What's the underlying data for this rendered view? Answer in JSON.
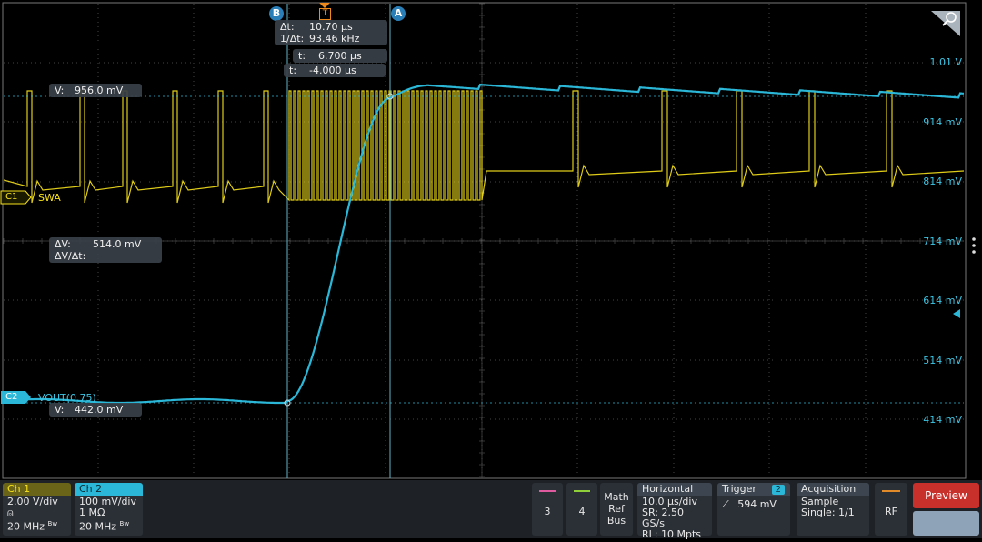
{
  "colors": {
    "ch1": "#f7e21c",
    "ch2": "#2bb8d8",
    "grid": "#444",
    "cursor": "#5fb3c8",
    "preview": "#c8302c",
    "ch3_bar": "#e05aa0",
    "ch4_bar": "#8fcf3a",
    "rf_bar": "#e08a2a"
  },
  "plot": {
    "ch1_marker": "C1",
    "ch1_label": "SWA",
    "ch2_marker": "C2",
    "ch2_label": "VOUT(0.75)",
    "y_labels": [
      "1.01 V",
      "914 mV",
      "814 mV",
      "714 mV",
      "614 mV",
      "514 mV",
      "414 mV"
    ],
    "trigger_marker": "T",
    "cursor_b": "B",
    "cursor_a": "A"
  },
  "readouts": {
    "delta_t_label": "Δt:",
    "delta_t": "10.70 µs",
    "inv_delta_t_label": "1/Δt:",
    "inv_delta_t": "93.46 kHz",
    "t_a_label": "t:",
    "t_a": "6.700 µs",
    "t_b_label": "t:",
    "t_b": "-4.000 µs",
    "v_upper_label": "V:",
    "v_upper": "956.0 mV",
    "delta_v_label": "ΔV:",
    "delta_v": "514.0 mV",
    "dv_dt_label": "ΔV/Δt:",
    "v_lower_label": "V:",
    "v_lower": "442.0 mV"
  },
  "bottom_bar": {
    "ch1": {
      "title": "Ch 1",
      "scale": "2.00 V/div",
      "coupling_icon": "dc-coupling-icon",
      "bw": "20 MHz",
      "bw_mark": "Bw"
    },
    "ch2": {
      "title": "Ch 2",
      "scale": "100 mV/div",
      "impedance": "1 MΩ",
      "bw": "20 MHz",
      "bw_mark": "Bw"
    },
    "ch3": "3",
    "ch4": "4",
    "math_ref_bus": [
      "Math",
      "Ref",
      "Bus"
    ],
    "horizontal": {
      "title": "Horizontal",
      "scale": "10.0 µs/div",
      "sr": "SR: 2.50 GS/s",
      "rl": "RL: 10 Mpts"
    },
    "trigger": {
      "title": "Trigger",
      "source": "2",
      "level": "594 mV",
      "slope_icon": "rising-edge-icon"
    },
    "acquisition": {
      "title": "Acquisition",
      "mode": "Sample",
      "state": "Single: 1/1"
    },
    "rf": "RF",
    "preview": "Preview"
  }
}
